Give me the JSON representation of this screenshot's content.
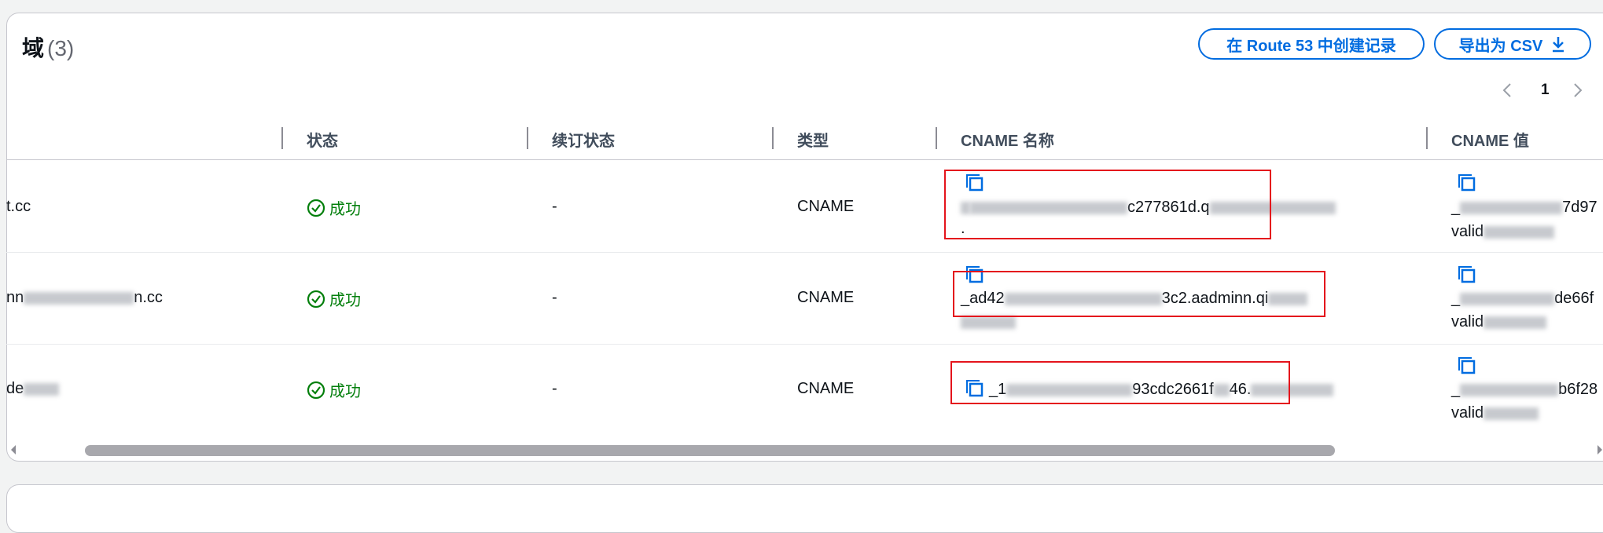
{
  "header": {
    "title": "域",
    "count": "(3)",
    "route53_button": "在 Route 53 中创建记录",
    "export_button": "导出为 CSV"
  },
  "pagination": {
    "current_page": "1"
  },
  "columns": {
    "status": "状态",
    "renewal_status": "续订状态",
    "type": "类型",
    "cname_name": "CNAME 名称",
    "cname_value": "CNAME 值"
  },
  "rows": [
    {
      "domain": "t.cc",
      "status": "成功",
      "renewal": "-",
      "type": "CNAME",
      "cname_name": "c277861d.q",
      "cname_name_line2": ".",
      "cname_value": "_",
      "cname_value_mid": "7d97",
      "cname_value_line2": "valid"
    },
    {
      "domain": "nn",
      "domain_tail": "n.cc",
      "status": "成功",
      "renewal": "-",
      "type": "CNAME",
      "cname_name": "_ad42",
      "cname_name_mid": "3c2.aadminn.qi",
      "cname_value": "_",
      "cname_value_mid": "de66f",
      "cname_value_line2": "valid"
    },
    {
      "domain": "de",
      "status": "成功",
      "renewal": "-",
      "type": "CNAME",
      "cname_name": "_1",
      "cname_name_mid": "93cdc2661f",
      "cname_name_tail": "46.",
      "cname_value": "_",
      "cname_value_mid": "b6f28",
      "cname_value_line2": "valid"
    }
  ],
  "icons": {
    "copy": "copy-icon",
    "success": "check-circle-icon",
    "download": "download-icon",
    "prev": "chevron-left-icon",
    "next": "chevron-right-icon"
  },
  "colors": {
    "accent": "#006ce0",
    "success": "#037f0c",
    "highlight": "#e4141c"
  }
}
